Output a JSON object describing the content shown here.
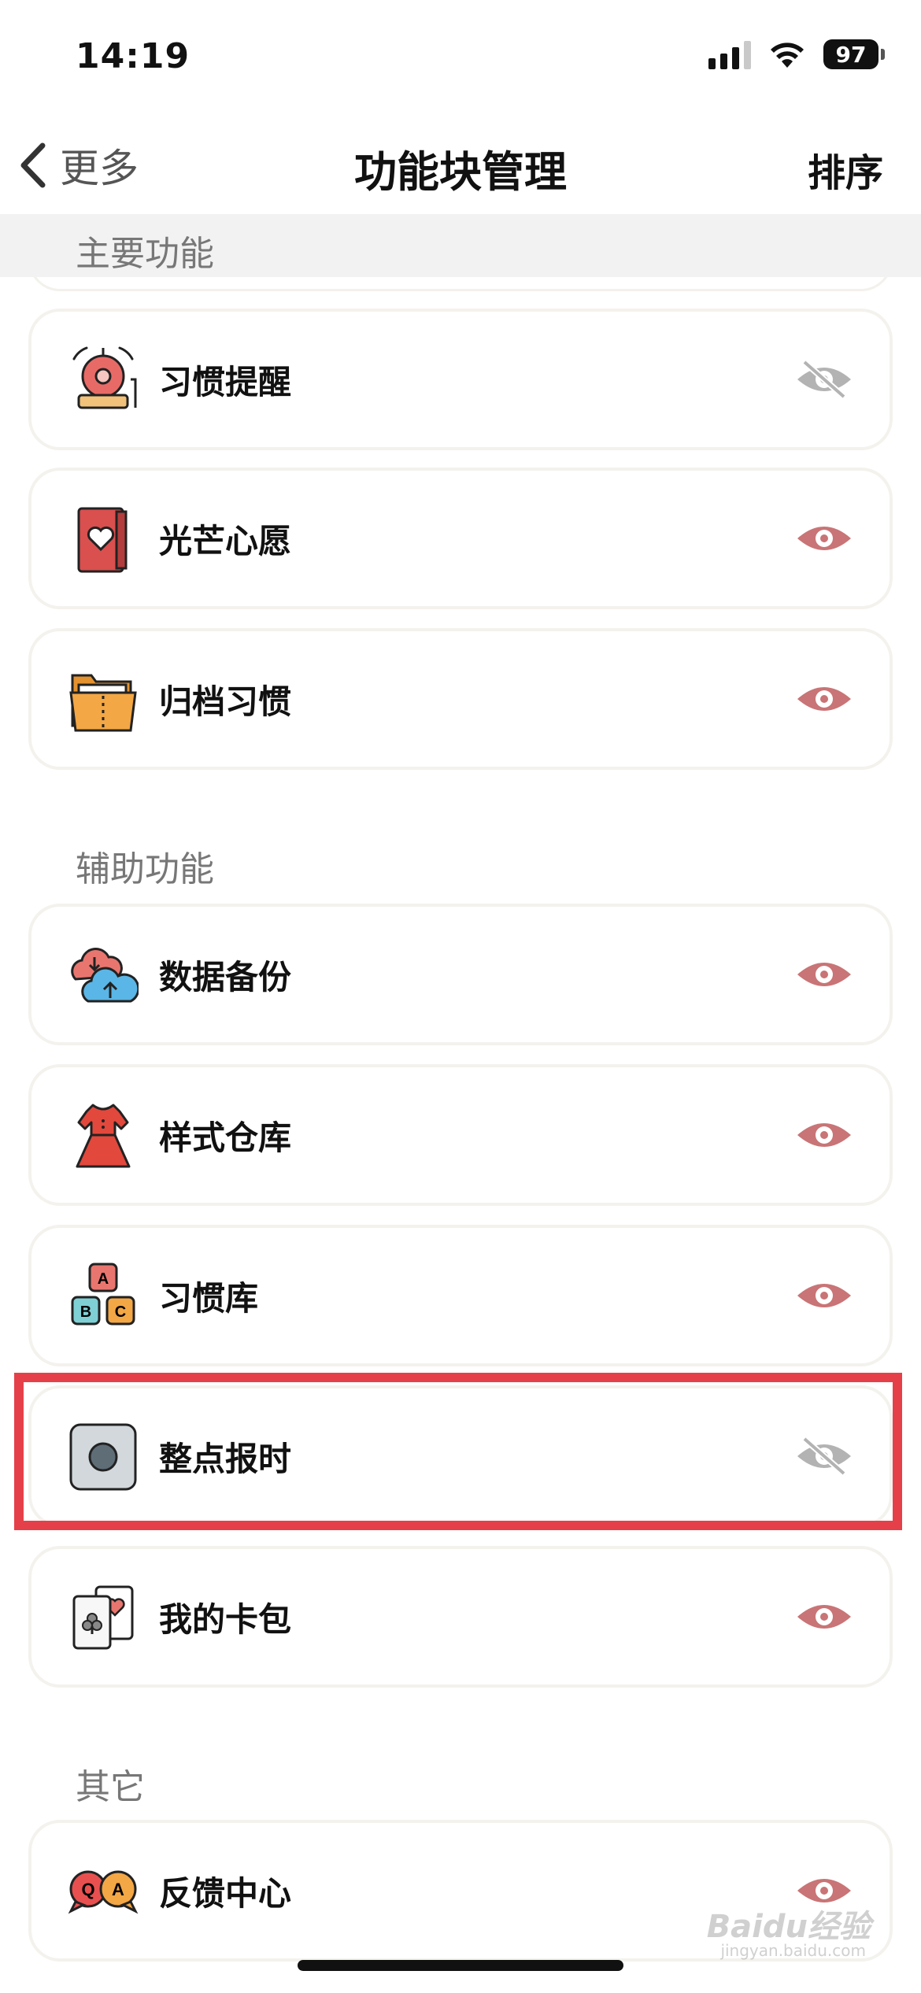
{
  "status_bar": {
    "time": "14:19",
    "battery": "97"
  },
  "nav": {
    "back_label": "更多",
    "title": "功能块管理",
    "sort_label": "排序"
  },
  "sticky_section": "主要功能",
  "sections": [
    {
      "title": "辅助功能"
    },
    {
      "title": "其它"
    }
  ],
  "items": [
    {
      "label": "习惯提醒",
      "icon": "alarm-bell-icon",
      "visible": false
    },
    {
      "label": "光芒心愿",
      "icon": "wish-card-icon",
      "visible": true
    },
    {
      "label": "归档习惯",
      "icon": "archive-folder-icon",
      "visible": true
    },
    {
      "label": "数据备份",
      "icon": "cloud-backup-icon",
      "visible": true
    },
    {
      "label": "样式仓库",
      "icon": "dress-icon",
      "visible": true
    },
    {
      "label": "习惯库",
      "icon": "abc-blocks-icon",
      "visible": true
    },
    {
      "label": "整点报时",
      "icon": "clock-button-icon",
      "visible": false
    },
    {
      "label": "我的卡包",
      "icon": "cards-icon",
      "visible": true
    },
    {
      "label": "反馈中心",
      "icon": "qa-bubbles-icon",
      "visible": true
    }
  ],
  "colors": {
    "eye_visible": "#c97476",
    "eye_hidden": "#b3b3b3",
    "highlight": "#e5404a"
  },
  "watermark": {
    "main": "Baidu经验",
    "sub": "jingyan.baidu.com"
  }
}
